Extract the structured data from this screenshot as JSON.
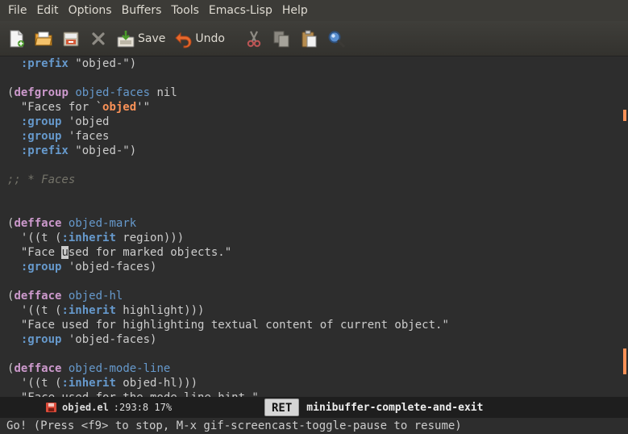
{
  "menubar": {
    "items": [
      "File",
      "Edit",
      "Options",
      "Buffers",
      "Tools",
      "Emacs-Lisp",
      "Help"
    ]
  },
  "toolbar": {
    "new_icon": "new-file-icon",
    "open_icon": "open-folder-icon",
    "dired_icon": "dired-icon",
    "close_icon": "close-buffer-icon",
    "save_label": "Save",
    "undo_label": "Undo",
    "cut_icon": "cut-icon",
    "copy_icon": "copy-icon",
    "paste_icon": "paste-icon",
    "search_icon": "search-icon"
  },
  "editor": {
    "lines": [
      [
        {
          "t": "  "
        },
        {
          "t": ":prefix",
          "c": "key"
        },
        {
          "t": " \"objed-\")",
          "c": "str"
        }
      ],
      [],
      [
        {
          "t": "("
        },
        {
          "t": "defgroup",
          "c": "kw"
        },
        {
          "t": " "
        },
        {
          "t": "objed-faces",
          "c": "fn"
        },
        {
          "t": " nil"
        }
      ],
      [
        {
          "t": "  \"Faces for `",
          "c": "str"
        },
        {
          "t": "objed",
          "c": "ref"
        },
        {
          "t": "'\"",
          "c": "str"
        }
      ],
      [
        {
          "t": "  "
        },
        {
          "t": ":group",
          "c": "key"
        },
        {
          "t": " 'objed"
        }
      ],
      [
        {
          "t": "  "
        },
        {
          "t": ":group",
          "c": "key"
        },
        {
          "t": " 'faces"
        }
      ],
      [
        {
          "t": "  "
        },
        {
          "t": ":prefix",
          "c": "key"
        },
        {
          "t": " \"objed-\")",
          "c": "str"
        }
      ],
      [],
      [
        {
          "t": ";; * Faces",
          "c": "cmt"
        }
      ],
      [],
      [],
      [
        {
          "t": "("
        },
        {
          "t": "defface",
          "c": "kw"
        },
        {
          "t": " "
        },
        {
          "t": "objed-mark",
          "c": "fn"
        }
      ],
      [
        {
          "t": "  '((t ("
        },
        {
          "t": ":inherit",
          "c": "key"
        },
        {
          "t": " region)))"
        }
      ],
      [
        {
          "t": "  \"Face ",
          "c": "str"
        },
        {
          "t": "u",
          "c": "cursor"
        },
        {
          "t": "sed for marked objects.\"",
          "c": "str"
        }
      ],
      [
        {
          "t": "  "
        },
        {
          "t": ":group",
          "c": "key"
        },
        {
          "t": " 'objed-faces)"
        }
      ],
      [],
      [
        {
          "t": "("
        },
        {
          "t": "defface",
          "c": "kw"
        },
        {
          "t": " "
        },
        {
          "t": "objed-hl",
          "c": "fn"
        }
      ],
      [
        {
          "t": "  '((t ("
        },
        {
          "t": ":inherit",
          "c": "key"
        },
        {
          "t": " highlight)))"
        }
      ],
      [
        {
          "t": "  \"Face used for highlighting textual content of current object.\"",
          "c": "str"
        }
      ],
      [
        {
          "t": "  "
        },
        {
          "t": ":group",
          "c": "key"
        },
        {
          "t": " 'objed-faces)"
        }
      ],
      [],
      [
        {
          "t": "("
        },
        {
          "t": "defface",
          "c": "kw"
        },
        {
          "t": " "
        },
        {
          "t": "objed-mode-line",
          "c": "fn"
        }
      ],
      [
        {
          "t": "  '((t ("
        },
        {
          "t": ":inherit",
          "c": "key"
        },
        {
          "t": " objed-hl)))"
        }
      ],
      [
        {
          "t": "  \"Face used for the mode line hint.\"",
          "c": "str"
        }
      ]
    ]
  },
  "modeline": {
    "buffer": "objed.el",
    "position": ":293:8 17%",
    "which_key": "RET",
    "which_cmd": "minibuffer-complete-and-exit"
  },
  "echo": "Go! (Press <f9> to stop, M-x gif-screencast-toggle-pause to resume)",
  "colors": {
    "background": "#2d2d2d",
    "keyword": "#cc99cc",
    "function": "#6699cc",
    "string": "#cccccc",
    "comment": "#747369",
    "highlight": "#f99157"
  }
}
